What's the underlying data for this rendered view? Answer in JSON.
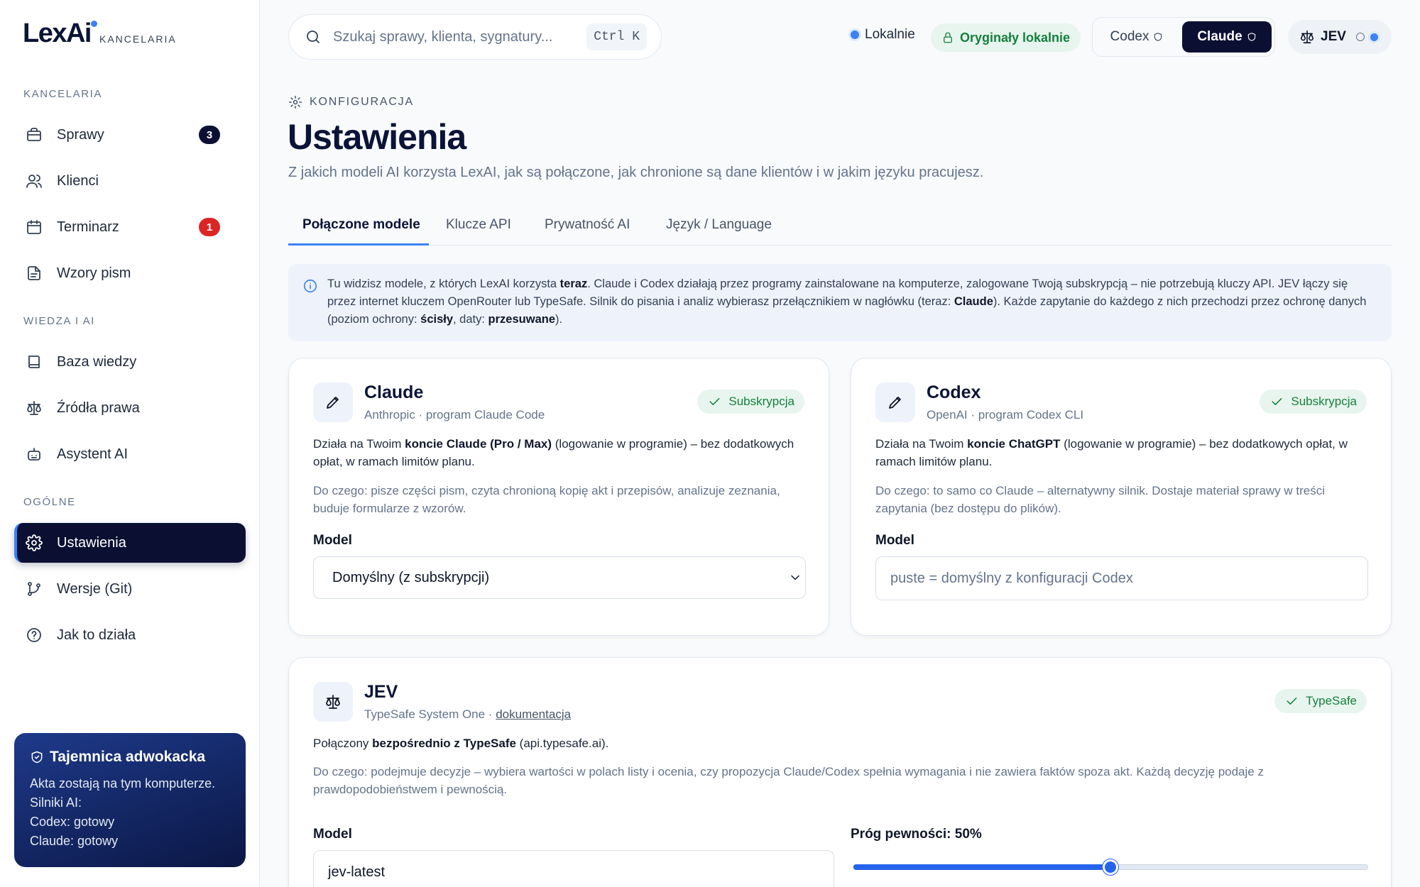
{
  "brand": {
    "name": "LexAi",
    "sub": "KANCELARIA"
  },
  "sidebar": {
    "sections": [
      "KANCELARIA",
      "WIEDZA I AI",
      "OGÓLNE"
    ],
    "items": [
      {
        "label": "Sprawy",
        "badge": "3"
      },
      {
        "label": "Klienci"
      },
      {
        "label": "Terminarz",
        "badge": "1"
      },
      {
        "label": "Wzory pism"
      },
      {
        "label": "Baza wiedzy"
      },
      {
        "label": "Źródła prawa"
      },
      {
        "label": "Asystent AI"
      },
      {
        "label": "Ustawienia"
      },
      {
        "label": "Wersje (Git)"
      },
      {
        "label": "Jak to działa"
      }
    ],
    "privacy": {
      "title": "Tajemnica adwokacka",
      "lines": [
        "Akta zostają na tym komputerze.",
        "Silniki AI:",
        "Codex: gotowy",
        "Claude: gotowy"
      ]
    }
  },
  "topbar": {
    "search_placeholder": "Szukaj sprawy, klienta, sygnatury...",
    "shortcut": "Ctrl K",
    "local_status": "Lokalnie",
    "originals": "Oryginały lokalnie",
    "engines": [
      "Codex",
      "Claude"
    ],
    "jev": "JEV"
  },
  "header": {
    "kicker": "KONFIGURACJA",
    "title": "Ustawienia",
    "subtitle": "Z jakich modeli AI korzysta LexAI, jak są połączone, jak chronione są dane klientów i w jakim języku pracujesz."
  },
  "tabs": [
    "Połączone modele",
    "Klucze API",
    "Prywatność AI",
    "Język / Language"
  ],
  "info": {
    "p1": "Tu widzisz modele, z których LexAI korzysta ",
    "b1": "teraz",
    "p2": ". Claude i Codex działają przez programy zainstalowane na komputerze, zalogowane Twoją subskrypcją – nie potrzebują kluczy API. JEV łączy się przez internet kluczem OpenRouter lub TypeSafe. Silnik do pisania i analiz wybierasz przełącznikiem w nagłówku (teraz: ",
    "b2": "Claude",
    "p3": "). Każde zapytanie do każdego z nich przechodzi przez ochronę danych (poziom ochrony: ",
    "b3": "ścisły",
    "p4": ", daty: ",
    "b4": "przesuwane",
    "p5": ")."
  },
  "cards": {
    "claude": {
      "name": "Claude",
      "meta": "Anthropic · program Claude Code",
      "badge": "Subskrypcja",
      "d1": "Działa na Twoim ",
      "db": "koncie Claude (Pro / Max)",
      "d2": " (logowanie w programie) – bez dodatkowych opłat, w ramach limitów planu.",
      "use": "Do czego: pisze części pism, czyta chronioną kopię akt i przepisów, analizuje zeznania, buduje formularze z wzorów.",
      "model_label": "Model",
      "model_value": "Domyślny (z subskrypcji)"
    },
    "codex": {
      "name": "Codex",
      "meta": "OpenAI · program Codex CLI",
      "badge": "Subskrypcja",
      "d1": "Działa na Twoim ",
      "db": "koncie ChatGPT",
      "d2": " (logowanie w programie) – bez dodatkowych opłat, w ramach limitów planu.",
      "use": "Do czego: to samo co Claude – alternatywny silnik. Dostaje materiał sprawy w treści zapytania (bez dostępu do plików).",
      "model_label": "Model",
      "model_placeholder": "puste = domyślny z konfiguracji Codex"
    },
    "jev": {
      "name": "JEV",
      "meta": "TypeSafe System One · ",
      "meta_link": "dokumentacja",
      "badge": "TypeSafe",
      "d1": "Połączony ",
      "db": "bezpośrednio z TypeSafe",
      "d2": " (api.typesafe.ai).",
      "use": "Do czego: podejmuje decyzje – wybiera wartości w polach listy i ocenia, czy propozycja Claude/Codex spełnia wymagania i nie zawiera faktów spoza akt. Każdą decyzję podaje z prawdopodobieństwem i pewnością.",
      "model_label": "Model",
      "model_value": "jev-latest",
      "threshold_label": "Próg pewności: ",
      "threshold_value": "50%",
      "threshold_fraction": 0.5
    }
  }
}
